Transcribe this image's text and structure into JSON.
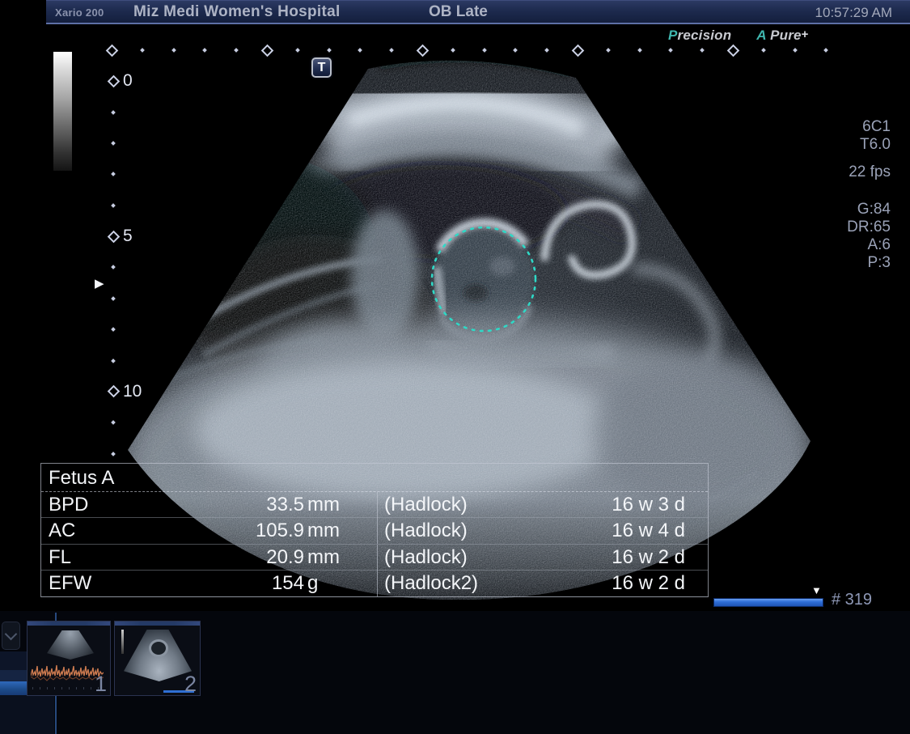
{
  "header": {
    "model": "Xario 200",
    "hospital": "Miz Medi Women's Hospital",
    "preset": "OB Late",
    "time": "10:57:29 AM"
  },
  "branding": {
    "precision_initial": "P",
    "precision_rest": "recision",
    "apure_initial": "A",
    "apure_rest": "Pure",
    "apure_plus": "+"
  },
  "imaging_params": {
    "probe": "6C1",
    "thermal_index": "T6.0",
    "frame_rate": "22 fps",
    "gain": "G:84",
    "dynamic_range": "DR:65",
    "a_value": "A:6",
    "p_value": "P:3"
  },
  "orientation_marker": "T",
  "depth_ruler": {
    "labels": [
      "0",
      "5",
      "10"
    ]
  },
  "measurements": {
    "title": "Fetus A",
    "rows": [
      {
        "label": "BPD",
        "value": "33.5",
        "unit": "mm",
        "method": "(Hadlock)",
        "ga": "16 w 3 d"
      },
      {
        "label": "AC",
        "value": "105.9",
        "unit": "mm",
        "method": "(Hadlock)",
        "ga": "16 w 4 d"
      },
      {
        "label": "FL",
        "value": "20.9",
        "unit": "mm",
        "method": "(Hadlock)",
        "ga": "16 w 2 d"
      },
      {
        "label": "EFW",
        "value": "154",
        "unit": "g",
        "method": "(Hadlock2)",
        "ga": "16 w 2 d"
      }
    ]
  },
  "frame_counter": "# 319",
  "thumbnails": [
    {
      "number": "1"
    },
    {
      "number": "2"
    }
  ],
  "colors": {
    "accent_teal": "#3fb6ae",
    "progress_blue": "#2f6fd8",
    "caliper_teal": "#2fd8c6",
    "topbar_navy": "#1d2a4e"
  }
}
